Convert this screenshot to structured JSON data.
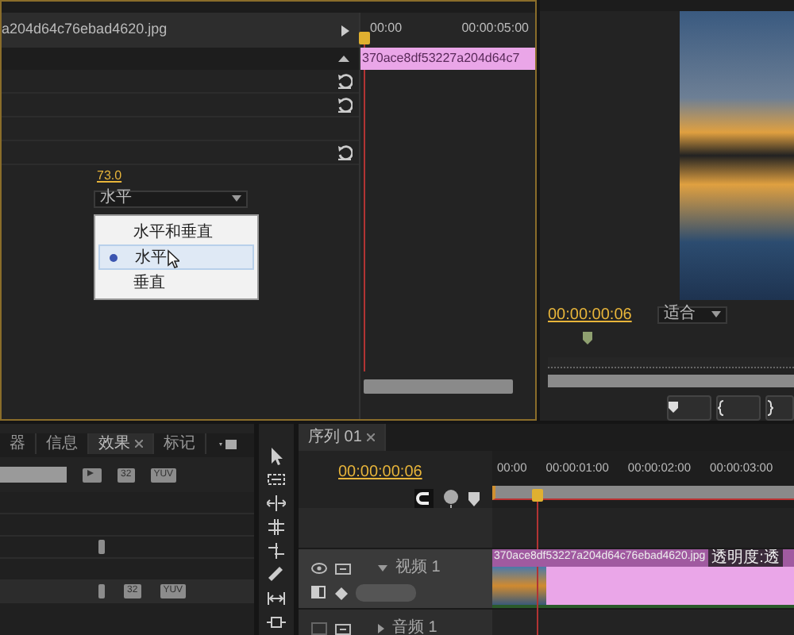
{
  "effect_controls": {
    "clip_name": "a204d64c76ebad4620.jpg",
    "ruler": [
      "00:00",
      "00:00:05:00"
    ],
    "clip_label": "370ace8df53227a204d64c7",
    "rows": [
      {
        "kind": "reset"
      },
      {
        "kind": "reset"
      },
      {
        "kind": "blank"
      },
      {
        "kind": "reset"
      }
    ],
    "value": "73.0",
    "dropdown": {
      "value": "水平",
      "menu": [
        {
          "label": "水平和垂直",
          "selected": false
        },
        {
          "label": "水平",
          "selected": true
        },
        {
          "label": "垂直",
          "selected": false
        }
      ]
    }
  },
  "program_monitor": {
    "timecode": "00:00:00:06",
    "fit": "适合"
  },
  "effects_panel": {
    "tabs": [
      {
        "label": "器",
        "selected": false,
        "closable": false
      },
      {
        "label": "信息",
        "selected": false,
        "closable": false
      },
      {
        "label": "效果",
        "selected": true,
        "closable": true
      },
      {
        "label": "标记",
        "selected": false,
        "closable": false
      }
    ],
    "toolbar_badges": [
      "32",
      "YUV"
    ],
    "row_badges": [
      "32",
      "YUV"
    ]
  },
  "timeline": {
    "tab": "序列 01",
    "timecode": "00:00:00:06",
    "ruler": [
      "00:00",
      "00:00:01:00",
      "00:00:02:00",
      "00:00:03:00"
    ],
    "tracks": [
      {
        "kind": "video",
        "name": "视频 1",
        "expanded": true,
        "clip": "370ace8df53227a204d64c76ebad4620.jpg",
        "clip_effect": "透明度:透"
      },
      {
        "kind": "audio",
        "name": "音频 1",
        "expanded": false
      }
    ]
  }
}
